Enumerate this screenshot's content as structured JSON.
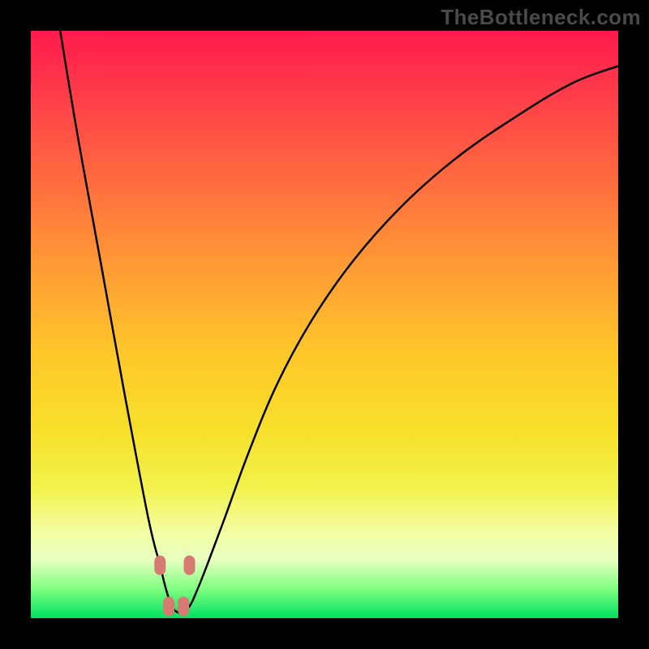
{
  "watermark": "TheBottleneck.com",
  "chart_data": {
    "type": "line",
    "title": "",
    "xlabel": "",
    "ylabel": "",
    "xlim": [
      0,
      100
    ],
    "ylim": [
      0,
      100
    ],
    "grid": false,
    "series": [
      {
        "name": "curve",
        "x": [
          5,
          8,
          12,
          16,
          20,
          22,
          23,
          24,
          25,
          26,
          27,
          28,
          30,
          33,
          37,
          42,
          48,
          55,
          63,
          72,
          82,
          92,
          100
        ],
        "values": [
          100,
          82,
          60,
          38,
          17,
          9,
          5,
          2,
          1,
          1,
          2,
          4,
          9,
          17,
          28,
          40,
          51,
          61,
          70,
          78,
          85,
          91,
          94
        ]
      }
    ],
    "markers": [
      {
        "x": 22,
        "y": 9
      },
      {
        "x": 27,
        "y": 9
      },
      {
        "x": 23.5,
        "y": 2
      },
      {
        "x": 26,
        "y": 2
      }
    ],
    "background_gradient": {
      "direction": "vertical",
      "stops": [
        {
          "pos": 0.0,
          "color": "#ff1a4d"
        },
        {
          "pos": 0.55,
          "color": "#ffc82a"
        },
        {
          "pos": 0.85,
          "color": "#f4fda0"
        },
        {
          "pos": 1.0,
          "color": "#00e060"
        }
      ]
    }
  }
}
